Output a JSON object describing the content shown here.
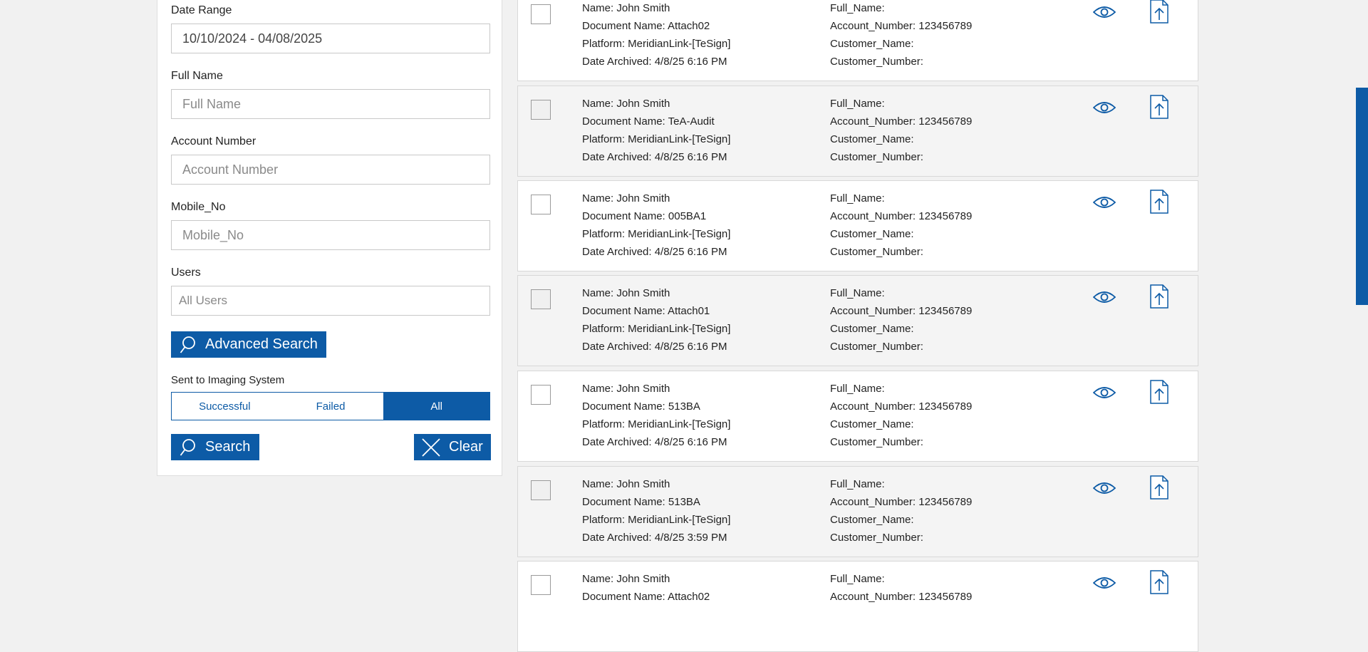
{
  "filters": {
    "date_range": {
      "label": "Date Range",
      "value": "10/10/2024 - 04/08/2025"
    },
    "full_name": {
      "label": "Full Name",
      "placeholder": "Full Name"
    },
    "account_number": {
      "label": "Account Number",
      "placeholder": "Account Number"
    },
    "mobile_no": {
      "label": "Mobile_No",
      "placeholder": "Mobile_No"
    },
    "users": {
      "label": "Users",
      "placeholder": "All Users"
    },
    "advanced_search_label": "Advanced Search",
    "sent_to_imaging": {
      "label": "Sent to Imaging System",
      "options": [
        "Successful",
        "Failed",
        "All"
      ],
      "selected": "All"
    },
    "search_label": "Search",
    "clear_label": "Clear"
  },
  "results": [
    {
      "name": "Name: John Smith",
      "document": "Document Name: Attach02",
      "platform": "Platform: MeridianLink-[TeSign]",
      "date": "Date Archived: 4/8/25 6:16 PM",
      "full_name": "Full_Name:",
      "account": "Account_Number: 123456789",
      "customer_name": "Customer_Name:",
      "customer_number": "Customer_Number:"
    },
    {
      "name": "Name: John Smith",
      "document": "Document Name: TeA-Audit",
      "platform": "Platform: MeridianLink-[TeSign]",
      "date": "Date Archived: 4/8/25 6:16 PM",
      "full_name": "Full_Name:",
      "account": "Account_Number: 123456789",
      "customer_name": "Customer_Name:",
      "customer_number": "Customer_Number:"
    },
    {
      "name": "Name: John Smith",
      "document": "Document Name: 005BA1",
      "platform": "Platform: MeridianLink-[TeSign]",
      "date": "Date Archived: 4/8/25 6:16 PM",
      "full_name": "Full_Name:",
      "account": "Account_Number: 123456789",
      "customer_name": "Customer_Name:",
      "customer_number": "Customer_Number:"
    },
    {
      "name": "Name: John Smith",
      "document": "Document Name: Attach01",
      "platform": "Platform: MeridianLink-[TeSign]",
      "date": "Date Archived: 4/8/25 6:16 PM",
      "full_name": "Full_Name:",
      "account": "Account_Number: 123456789",
      "customer_name": "Customer_Name:",
      "customer_number": "Customer_Number:"
    },
    {
      "name": "Name: John Smith",
      "document": "Document Name: 513BA",
      "platform": "Platform: MeridianLink-[TeSign]",
      "date": "Date Archived: 4/8/25 6:16 PM",
      "full_name": "Full_Name:",
      "account": "Account_Number: 123456789",
      "customer_name": "Customer_Name:",
      "customer_number": "Customer_Number:"
    },
    {
      "name": "Name: John Smith",
      "document": "Document Name: 513BA",
      "platform": "Platform: MeridianLink-[TeSign]",
      "date": "Date Archived: 4/8/25 3:59 PM",
      "full_name": "Full_Name:",
      "account": "Account_Number: 123456789",
      "customer_name": "Customer_Name:",
      "customer_number": "Customer_Number:"
    },
    {
      "name": "Name: John Smith",
      "document": "Document Name: Attach02",
      "platform": "",
      "date": "",
      "full_name": "Full_Name:",
      "account": "Account_Number: 123456789",
      "customer_name": "",
      "customer_number": ""
    }
  ],
  "icons": {
    "view": "eye-icon",
    "upload": "file-upload-icon",
    "search": "search-icon",
    "clear": "close-icon"
  },
  "colors": {
    "accent": "#0d5ba6",
    "page_bg": "#f1f1f1",
    "alt_row": "#f4f4f4"
  }
}
